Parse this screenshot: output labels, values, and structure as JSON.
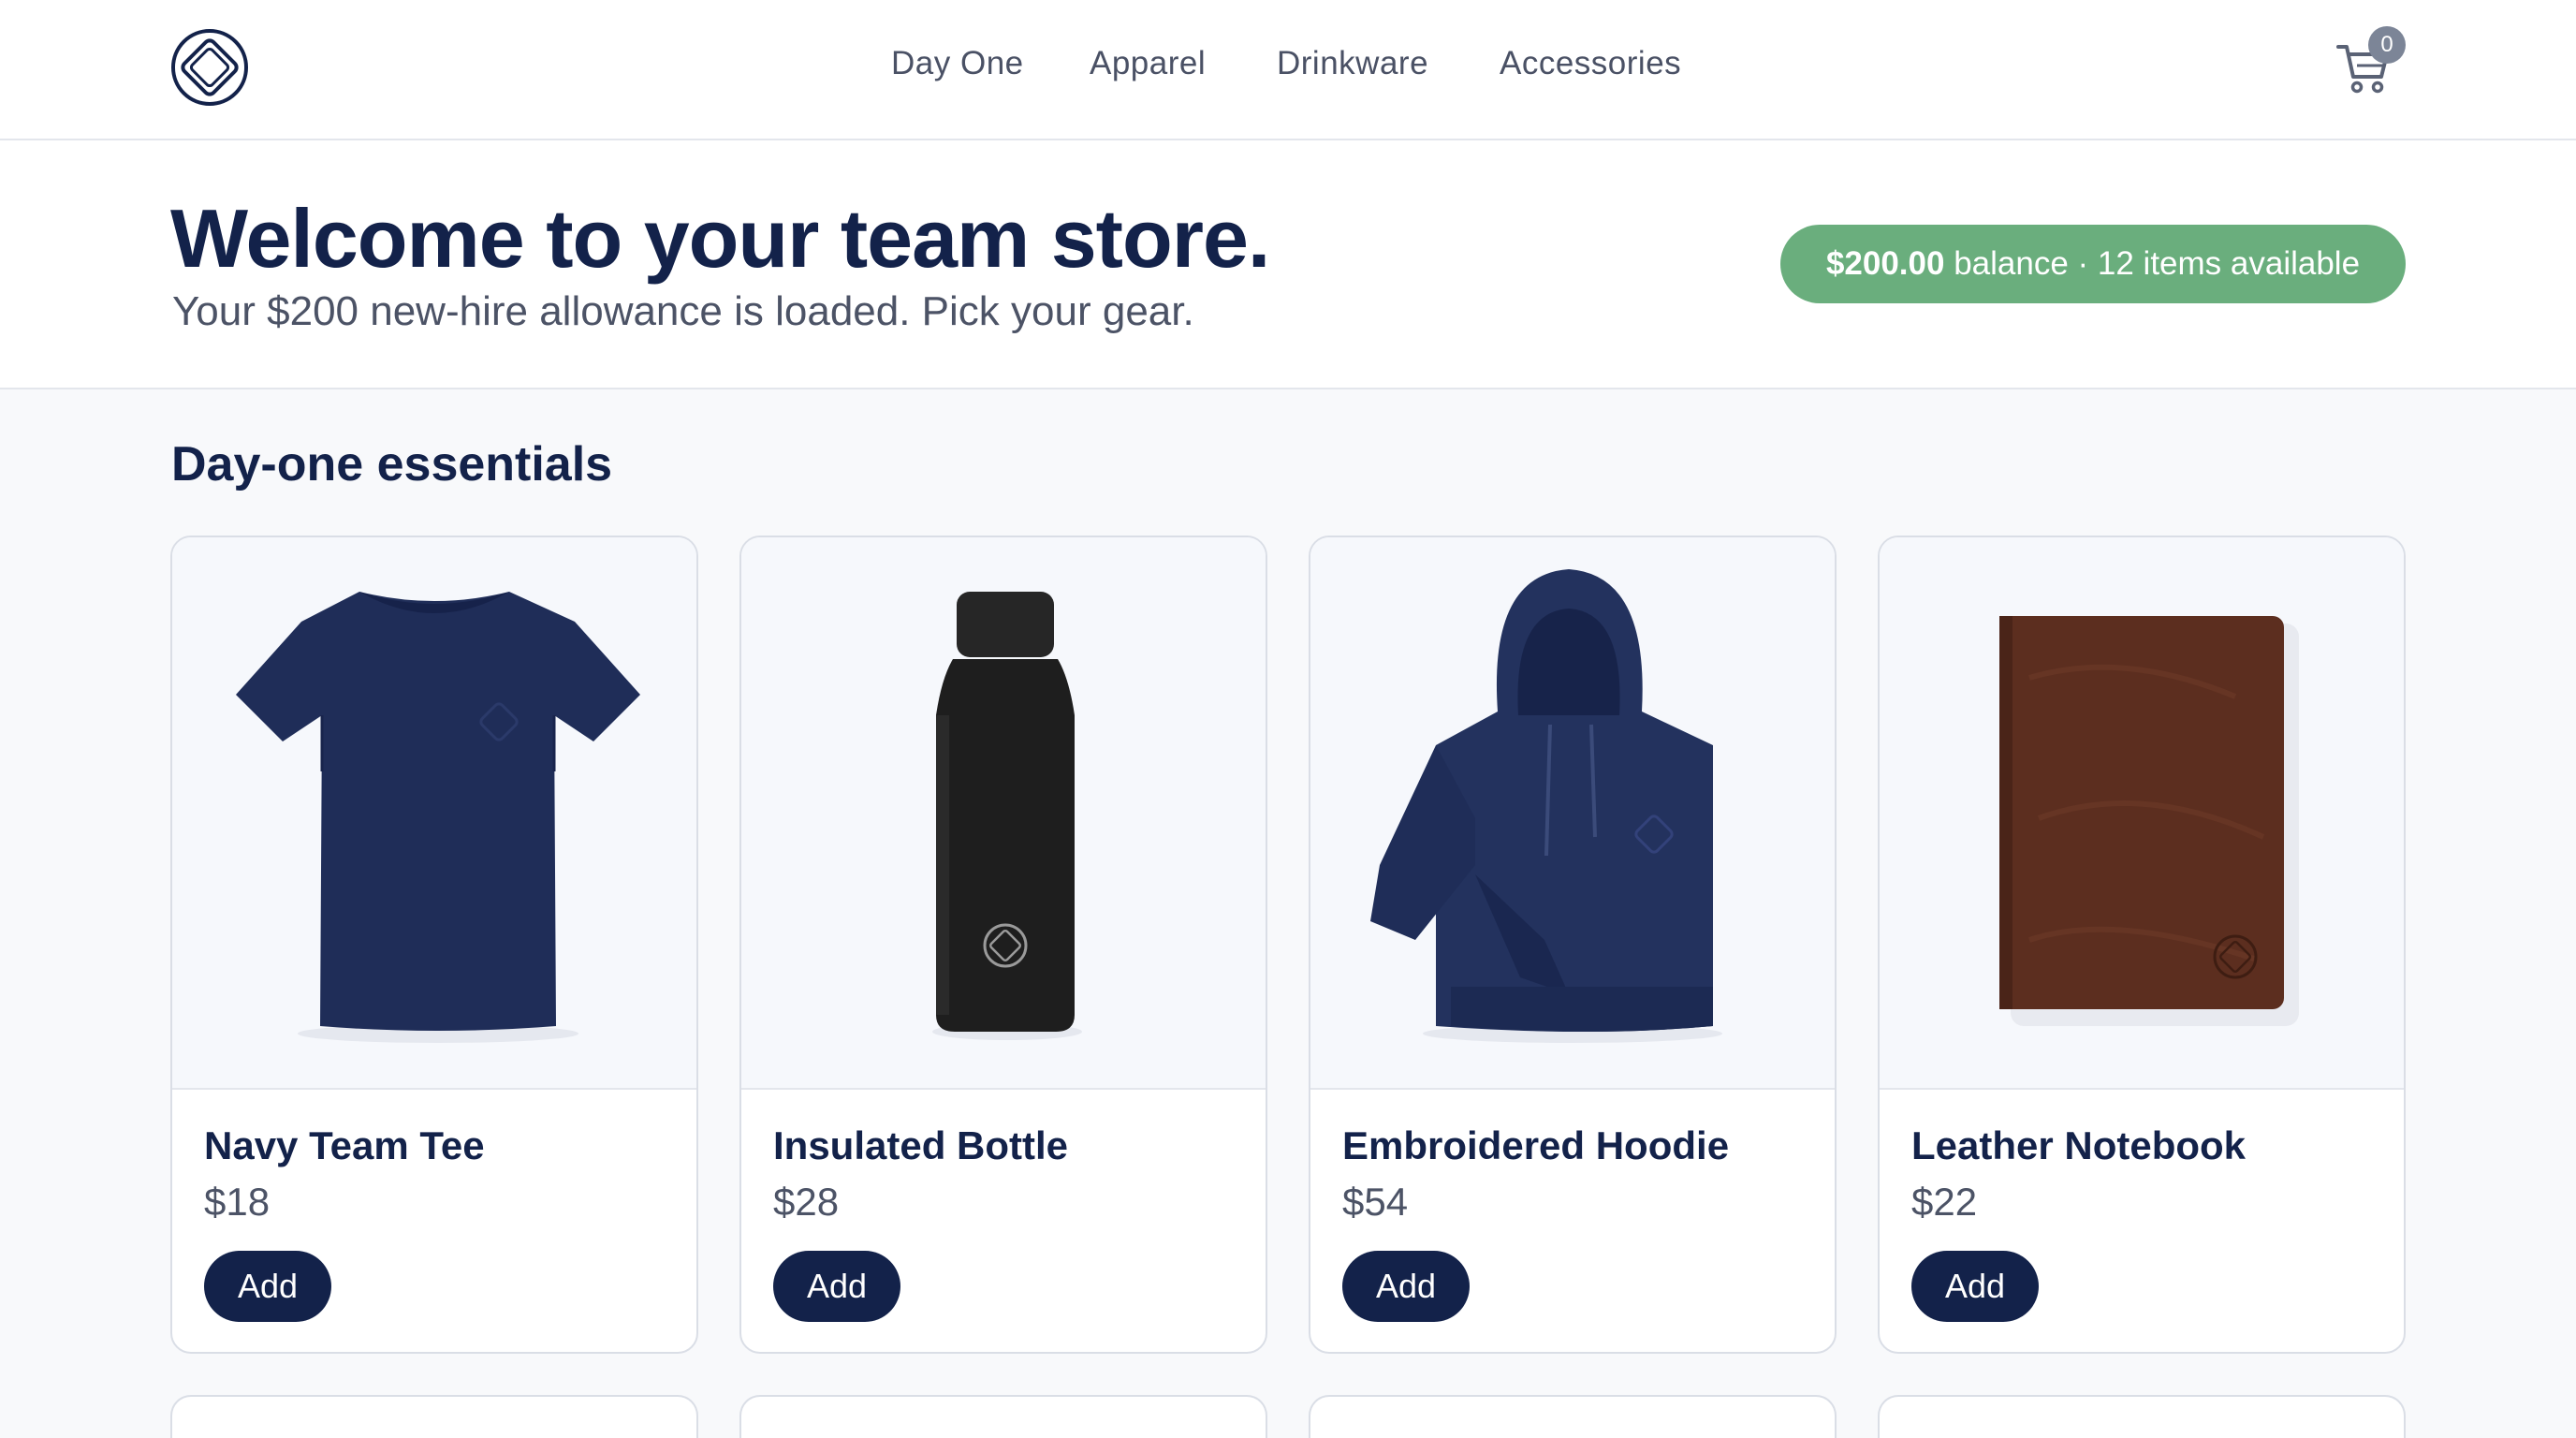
{
  "nav": {
    "items": [
      {
        "label": "Day One"
      },
      {
        "label": "Apparel"
      },
      {
        "label": "Drinkware"
      },
      {
        "label": "Accessories"
      }
    ],
    "cart_count": "0"
  },
  "hero": {
    "title": "Welcome to your team store.",
    "subtitle": "Your $200 new-hire allowance is loaded. Pick your gear.",
    "balance_amount": "$200.00",
    "balance_rest": " balance · 12 items available"
  },
  "section": {
    "title": "Day-one essentials"
  },
  "products": [
    {
      "name": "Navy Team Tee",
      "price": "$18",
      "add_label": "Add",
      "image": "navy-tshirt"
    },
    {
      "name": "Insulated Bottle",
      "price": "$28",
      "add_label": "Add",
      "image": "black-bottle"
    },
    {
      "name": "Embroidered Hoodie",
      "price": "$54",
      "add_label": "Add",
      "image": "navy-hoodie"
    },
    {
      "name": "Leather Notebook",
      "price": "$22",
      "add_label": "Add",
      "image": "brown-notebook"
    }
  ],
  "colors": {
    "brand_navy": "#13224a",
    "balance_green": "#6aae7d",
    "page_bg": "#f8f9fb"
  }
}
